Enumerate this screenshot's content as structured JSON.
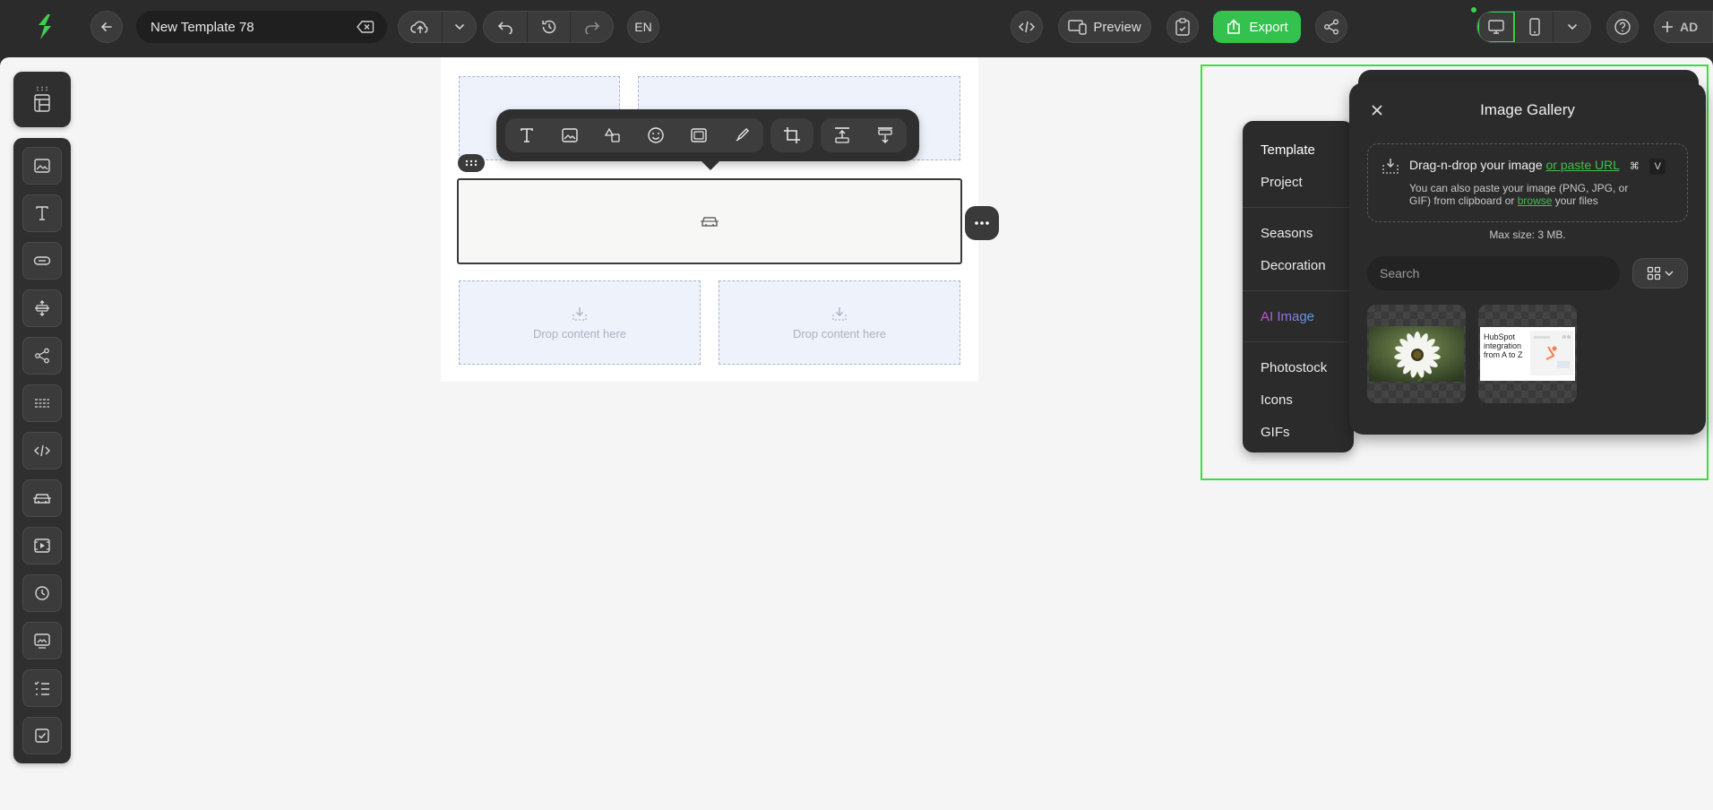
{
  "app": {
    "template_name": "New Template 78",
    "language": "EN",
    "preview_label": "Preview",
    "export_label": "Export",
    "avatar_initials": "AD"
  },
  "colors": {
    "accent_green": "#33c24d",
    "highlight": "#39e03c",
    "dark_panel": "#2b2b2b"
  },
  "canvas": {
    "drop_label_1": "Drop content here",
    "drop_label_2": "Drop content here"
  },
  "sidebar": {
    "blocks": [
      "image-block-icon",
      "text-block-icon",
      "button-block-icon",
      "spacer-block-icon",
      "social-block-icon",
      "divider-block-icon",
      "html-block-icon",
      "menu-block-icon",
      "video-block-icon",
      "timer-block-icon",
      "banner-block-icon",
      "list-block-icon",
      "checkbox-block-icon"
    ]
  },
  "toolbar": {
    "buttons": [
      "text-icon",
      "image-icon",
      "shapes-icon",
      "emoji-icon",
      "frame-icon",
      "brush-icon",
      "crop-icon",
      "align-top-icon",
      "align-middle-icon"
    ]
  },
  "categories": {
    "template": "Template",
    "project": "Project",
    "seasons": "Seasons",
    "decoration": "Decoration",
    "ai_image": "AI Image",
    "photostock": "Photostock",
    "icons": "Icons",
    "gifs": "GIFs"
  },
  "gallery": {
    "title": "Image Gallery",
    "drop_text": "Drag-n-drop your image",
    "paste_link": "or paste URL",
    "shortcut_cmd": "⌘",
    "shortcut_key": "V",
    "hint_part1": "You can also paste your image (PNG, JPG, or GIF) from clipboard or",
    "hint_link": "browse",
    "hint_part2": "your files",
    "max_size": "Max size: 3 MB.",
    "search_placeholder": "Search",
    "thumb2_text": "HubSpot integration from A to Z"
  }
}
